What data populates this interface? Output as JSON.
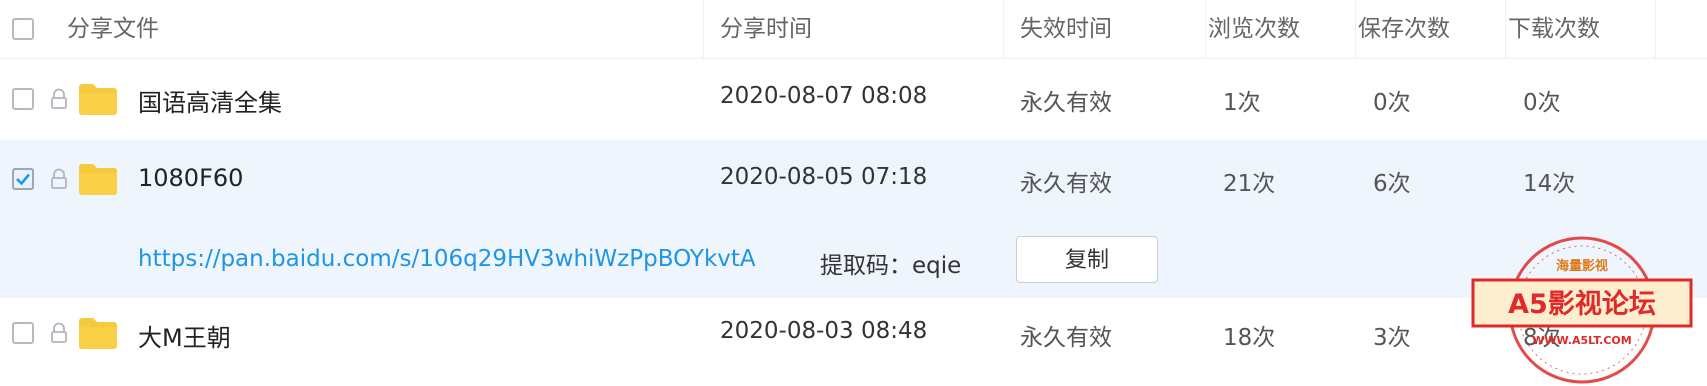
{
  "header": {
    "file_label": "分享文件",
    "share_time_label": "分享时间",
    "expire_label": "失效时间",
    "views_label": "浏览次数",
    "saves_label": "保存次数",
    "downloads_label": "下载次数"
  },
  "rows": [
    {
      "name": "国语高清全集",
      "share_time": "2020-08-07 08:08",
      "expire": "永久有效",
      "views": "1次",
      "saves": "0次",
      "downloads": "0次",
      "checked": false
    },
    {
      "name": "1080F60",
      "share_time": "2020-08-05 07:18",
      "expire": "永久有效",
      "views": "21次",
      "saves": "6次",
      "downloads": "14次",
      "checked": true
    },
    {
      "name": "大M王朝",
      "share_time": "2020-08-03 08:48",
      "expire": "永久有效",
      "views": "18次",
      "saves": "3次",
      "downloads": "8次",
      "checked": false
    }
  ],
  "share_link": {
    "url": "https://pan.baidu.com/s/106q29HV3whiWzPpBOYkvtA",
    "code_label": "提取码：eqie",
    "copy_button": "复制"
  },
  "watermark": {
    "top_text": "海量影视",
    "main_text": "A5影视论坛",
    "url_text": "WWW.A5LT.COM"
  },
  "colors": {
    "accent": "#1e95e6",
    "selected_row_bg": "#eef5fd",
    "folder": "#f7c93c",
    "stamp_red": "#e02a2a"
  }
}
